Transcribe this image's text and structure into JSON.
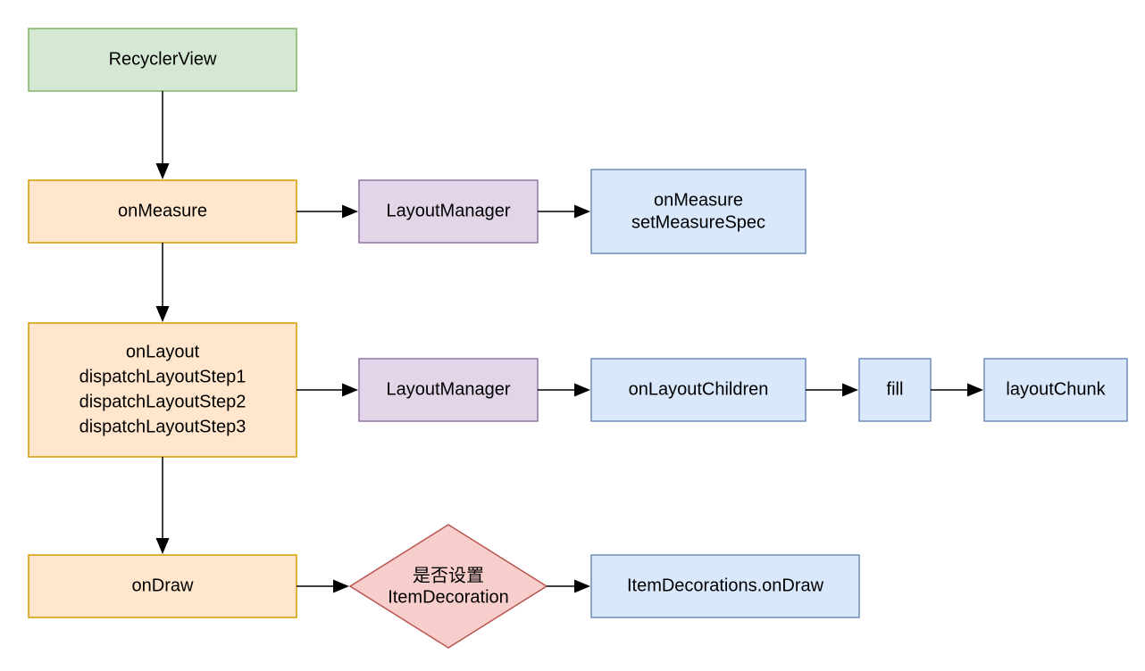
{
  "nodes": {
    "recyclerview": "RecyclerView",
    "onmeasure": "onMeasure",
    "layoutmanager1": "LayoutManager",
    "onmeasure_spec_l1": "onMeasure",
    "onmeasure_spec_l2": "setMeasureSpec",
    "onlayout_l1": "onLayout",
    "onlayout_l2": "dispatchLayoutStep1",
    "onlayout_l3": "dispatchLayoutStep2",
    "onlayout_l4": "dispatchLayoutStep3",
    "layoutmanager2": "LayoutManager",
    "onlayoutchildren": "onLayoutChildren",
    "fill": "fill",
    "layoutchunk": "layoutChunk",
    "ondraw": "onDraw",
    "decision_l1": "是否设置",
    "decision_l2": "ItemDecoration",
    "itemdecorations": "ItemDecorations.onDraw"
  }
}
